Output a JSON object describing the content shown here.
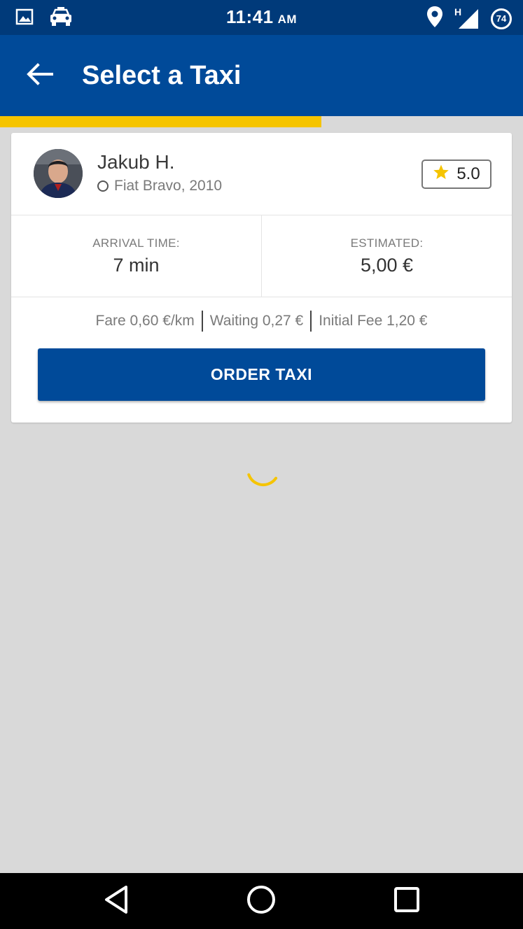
{
  "status_bar": {
    "time": "11:41",
    "ampm": "AM",
    "network_type": "H",
    "battery_level": "74",
    "left_icons": [
      "image-icon",
      "taxi-icon"
    ],
    "right_icons": [
      "location-pin-icon",
      "signal-icon",
      "battery-icon"
    ]
  },
  "app_bar": {
    "title": "Select a Taxi",
    "back_icon": "arrow-left-icon"
  },
  "progress": {
    "fraction": 0.614,
    "color": "#f5c400"
  },
  "driver": {
    "name": "Jakub H.",
    "car": "Fiat Bravo, 2010",
    "rating": "5.0"
  },
  "trip": {
    "arrival_label": "ARRIVAL TIME:",
    "arrival_value": "7 min",
    "estimated_label": "ESTIMATED:",
    "estimated_value": "5,00 €"
  },
  "fares": {
    "fare": "Fare 0,60 €/km",
    "waiting": "Waiting 0,27 €",
    "initial_fee": "Initial Fee 1,20 €"
  },
  "order_button": {
    "label": "ORDER TAXI"
  },
  "colors": {
    "status_bar": "#003a7a",
    "app_bar": "#004a99",
    "accent": "#f5c400",
    "background": "#d9d9d9"
  },
  "nav_bar": {
    "icons": [
      "back-triangle-icon",
      "home-circle-icon",
      "recents-square-icon"
    ]
  }
}
